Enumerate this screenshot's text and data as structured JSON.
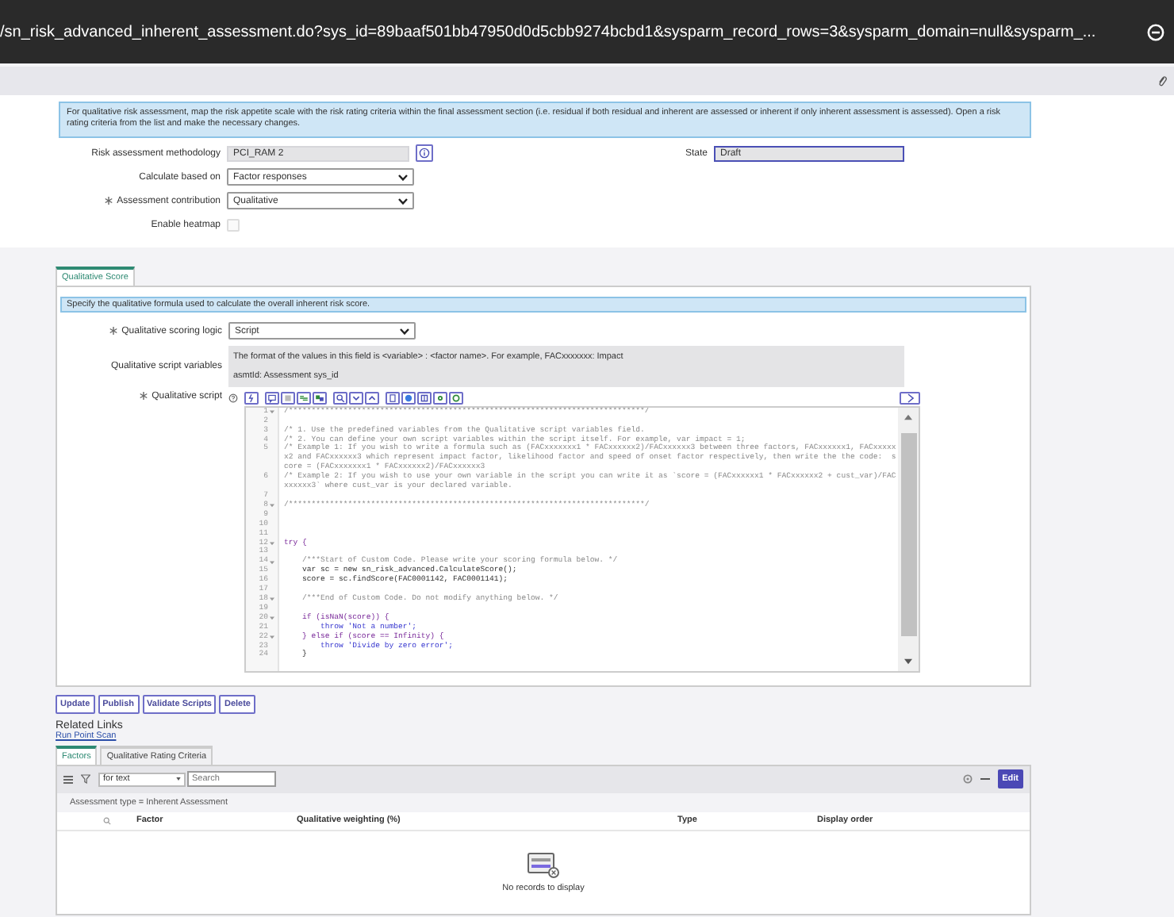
{
  "url_bar": {
    "text": "/sn_risk_advanced_inherent_assessment.do?sys_id=89baaf501bb47950d0d5cbb9274bcbd1&sysparm_record_rows=3&sysparm_domain=null&sysparm_..."
  },
  "info_message": "For qualitative risk assessment, map the risk appetite scale with the risk rating criteria within the final assessment section (i.e. residual if both residual and inherent are assessed or inherent if only inherent assessment is assessed). Open a risk rating criteria from the list and make the necessary changes.",
  "form": {
    "left_fields": [
      {
        "kind": "reference",
        "label": "Risk assessment methodology",
        "value": "PCI_RAM 2",
        "mandatory": false
      },
      {
        "kind": "select",
        "label": "Calculate based on",
        "value": "Factor responses",
        "mandatory": false
      },
      {
        "kind": "select",
        "label": "Assessment contribution",
        "value": "Qualitative",
        "mandatory": true
      },
      {
        "kind": "checkbox",
        "label": "Enable heatmap",
        "checked": false,
        "mandatory": false
      }
    ],
    "right_fields": [
      {
        "kind": "readonly",
        "label": "State",
        "value": "Draft",
        "mandatory": false
      }
    ]
  },
  "section_tabs": [
    {
      "label": "Qualitative Score",
      "selected": true
    }
  ],
  "section": {
    "message": "Specify the qualitative formula used to calculate the overall inherent risk score.",
    "fields": [
      {
        "kind": "select",
        "label": "Qualitative scoring logic",
        "value": "Script",
        "mandatory": true
      },
      {
        "kind": "textblock",
        "label": "Qualitative script variables",
        "lines": [
          "The format of the values in this field is <variable> : <factor name>. For example, FACxxxxxxx: Impact",
          "asmtId: Assessment sys_id"
        ],
        "mandatory": false
      },
      {
        "kind": "script",
        "label": "Qualitative script",
        "mandatory": true
      }
    ]
  },
  "editor": {
    "lines": [
      {
        "number": "1",
        "kind": "comment",
        "foldable": true,
        "text": "/******************************************************************************/"
      },
      {
        "number": "2",
        "kind": "code",
        "foldable": false
      },
      {
        "number": "3",
        "kind": "comment",
        "foldable": false,
        "text": "/* 1. Use the predefined variables from the Qualitative script variables field."
      },
      {
        "number": "4",
        "kind": "comment",
        "foldable": false,
        "text": "/* 2. You can define your own script variables within the script itself. For example, var impact = 1;"
      },
      {
        "number": "5",
        "kind": "comment",
        "foldable": false,
        "text": "/* Example 1: If you wish to write a formula such as (FACxxxxxxx1 * FACxxxxxx2)/FACxxxxxx3 between three factors, FACxxxxxx1, FACxxxxxx2 and FACxxxxxx3 which represent impact factor, likelihood factor and speed of onset factor respectively, then write the the code:  score = (FACxxxxxxx1 * FACxxxxxx2)/FACxxxxxx3"
      },
      {
        "number": "6",
        "kind": "comment",
        "foldable": false,
        "text": "/* Example 2: If you wish to use your own variable in the script you can write it as `score = (FACxxxxxx1 * FACxxxxxx2 + cust_var)/FACxxxxxx3` where cust_var is your declared variable."
      },
      {
        "number": "7",
        "kind": "code",
        "foldable": false
      },
      {
        "number": "8",
        "kind": "comment",
        "foldable": true,
        "text": "/******************************************************************************/"
      },
      {
        "number": "9",
        "kind": "code",
        "foldable": false
      },
      {
        "number": "10",
        "kind": "code",
        "foldable": false
      },
      {
        "number": "11",
        "kind": "code",
        "foldable": false
      },
      {
        "number": "12",
        "kind": "keyword",
        "foldable": true,
        "text": "try {"
      },
      {
        "number": "13",
        "kind": "code",
        "foldable": false
      },
      {
        "number": "14",
        "kind": "comment",
        "foldable": true,
        "text": "    /***Start of Custom Code. Please write your scoring formula below. */"
      },
      {
        "number": "15",
        "kind": "code",
        "foldable": false,
        "text": "    var sc = new sn_risk_advanced.CalculateScore();"
      },
      {
        "number": "16",
        "kind": "code",
        "foldable": false,
        "text": "    score = sc.findScore(FAC0001142, FAC0001141);"
      },
      {
        "number": "17",
        "kind": "code",
        "foldable": false
      },
      {
        "number": "18",
        "kind": "comment",
        "foldable": true,
        "text": "    /***End of Custom Code. Do not modify anything below. */"
      },
      {
        "number": "19",
        "kind": "code",
        "foldable": false
      },
      {
        "number": "20",
        "kind": "keyword",
        "foldable": true,
        "text": "    if (isNaN(score)) {"
      },
      {
        "number": "21",
        "kind": "string",
        "foldable": false,
        "text": "        throw 'Not a number';"
      },
      {
        "number": "22",
        "kind": "keyword",
        "foldable": true,
        "text": "    } else if (score == Infinity) {"
      },
      {
        "number": "23",
        "kind": "string",
        "foldable": false,
        "text": "        throw 'Divide by zero error';"
      },
      {
        "number": "24",
        "kind": "code",
        "foldable": false,
        "text": "    }"
      }
    ]
  },
  "buttons": [
    "Update",
    "Publish",
    "Validate Scripts",
    "Delete"
  ],
  "related_links": {
    "title": "Related Links",
    "links": [
      "Run Point Scan"
    ]
  },
  "related_tabs": [
    {
      "label": "Factors",
      "selected": true
    },
    {
      "label": "Qualitative Rating Criteria",
      "selected": false
    }
  ],
  "list": {
    "filter_select": "for text",
    "search_placeholder": "Search",
    "edit_button": "Edit",
    "breadcrumb": "Assessment type = Inherent Assessment",
    "columns": [
      "Factor",
      "Qualitative weighting (%)",
      "Type",
      "Display order"
    ],
    "empty_message": "No records to display"
  }
}
